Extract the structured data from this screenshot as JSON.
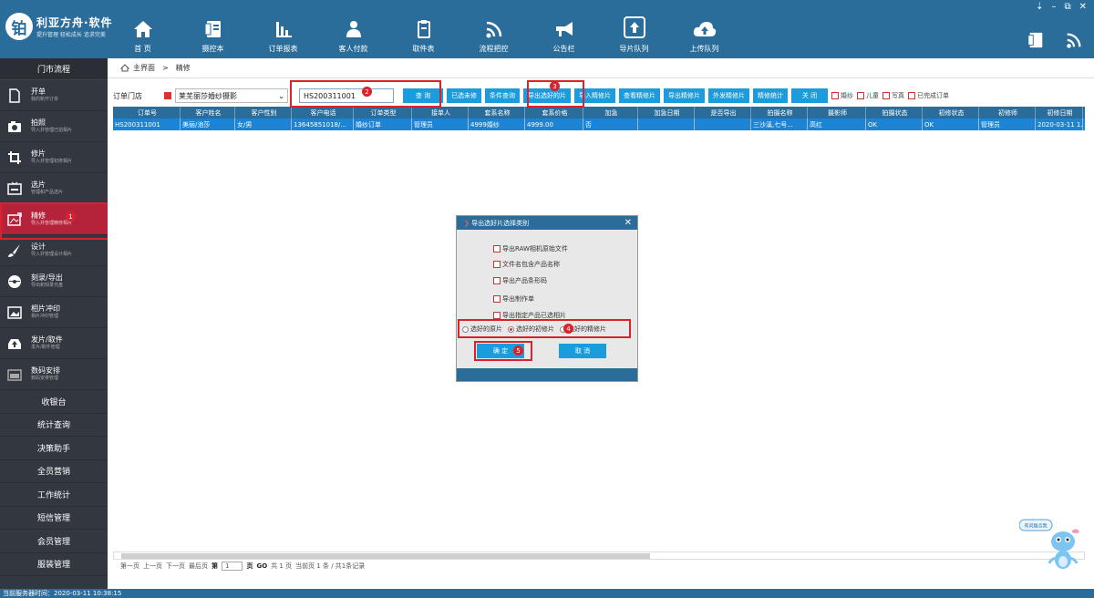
{
  "app": {
    "name": "利亚方舟·软件",
    "slogan": "提升管理 轻松成长 追求完美",
    "logo_char": "铂"
  },
  "topnav": [
    {
      "label": "首 页",
      "icon": "home-icon"
    },
    {
      "label": "摄控本",
      "icon": "notebook-icon"
    },
    {
      "label": "订单报表",
      "icon": "bar-chart-icon"
    },
    {
      "label": "客人付款",
      "icon": "customer-icon"
    },
    {
      "label": "取件表",
      "icon": "clipboard-icon"
    },
    {
      "label": "流程把控",
      "icon": "signal-icon"
    },
    {
      "label": "公告栏",
      "icon": "megaphone-icon"
    },
    {
      "label": "导片队列",
      "icon": "upload-box-icon"
    },
    {
      "label": "上传队列",
      "icon": "cloud-upload-icon"
    }
  ],
  "window": {
    "controls": [
      "⇣",
      "–",
      "⧉",
      "✕"
    ]
  },
  "sidebar": {
    "header": "门市流程",
    "items": [
      {
        "title": "开单",
        "sub": "我的新开订单",
        "icon": "document-icon"
      },
      {
        "title": "拍照",
        "sub": "导入并管理已拍相片",
        "icon": "camera-icon"
      },
      {
        "title": "修片",
        "sub": "导入并管理初修相片",
        "icon": "crop-icon"
      },
      {
        "title": "选片",
        "sub": "管理和产品选片",
        "icon": "screen-icon"
      },
      {
        "title": "精修",
        "sub": "导入并管理精修相片",
        "icon": "image-edit-icon"
      },
      {
        "title": "设计",
        "sub": "导入并管理设计相片",
        "icon": "brush-icon"
      },
      {
        "title": "刻录/导出",
        "sub": "导出和刻录光盘",
        "icon": "disc-icon"
      },
      {
        "title": "相片冲印",
        "sub": "相片冲印管理",
        "icon": "photo-icon"
      },
      {
        "title": "发片/取件",
        "sub": "发片/取件管理",
        "icon": "tray-upload-icon"
      },
      {
        "title": "数码安排",
        "sub": "数码安排管理",
        "icon": "calendar-icon"
      }
    ],
    "plain": [
      "收银台",
      "统计查询",
      "决策助手",
      "全员营销",
      "工作统计",
      "短信管理",
      "会员管理",
      "服装管理"
    ]
  },
  "breadcrumb": {
    "home": "主界面",
    "sep": ">",
    "current": "精修"
  },
  "toolbar": {
    "store_select": "订单门店",
    "studio_select": "莱芜丽莎婚纱摄影",
    "order_input": "HS200311001",
    "buttons": [
      "查 询",
      "已选未修",
      "条件查询",
      "导出选好的片",
      "导入精修片",
      "查看精修片",
      "导出精修片",
      "外发精修片",
      "精修统计",
      "关 闭"
    ],
    "checks": [
      "婚纱",
      "儿童",
      "写真",
      "已完成订单"
    ]
  },
  "table": {
    "columns": [
      "订单号",
      "客户姓名",
      "客户性别",
      "客户电话",
      "订单类型",
      "接单人",
      "套系名称",
      "套系价格",
      "加急",
      "加急日期",
      "是否导出",
      "拍摄名称",
      "摄影师",
      "拍摄状态",
      "初修状态",
      "初修师",
      "初修日期"
    ],
    "rows": [
      [
        "HS200311001",
        "美丽/池莎",
        "女/男",
        "13645851018/...",
        "婚纱订单",
        "管理员",
        "4999婚纱",
        "4999.00",
        "否",
        "",
        "",
        "三沙溪,七号...",
        "高红",
        "OK",
        "OK",
        "管理员",
        "2020-03-11 1..."
      ]
    ]
  },
  "pager": {
    "first": "第一页",
    "prev": "上一页",
    "next": "下一页",
    "last": "最后页",
    "page_prefix": "第",
    "page_value": "1",
    "page_suffix": "页",
    "go": "GO",
    "total": "共 1 页",
    "current": "当前页 1 条 / 共1条记录"
  },
  "dialog": {
    "title": "导出选好片选择类别",
    "options": [
      "导出RAW相机原始文件",
      "文件名包含产品名称",
      "导出产品条形码",
      "导出制作单",
      "导出指定产品已选相片"
    ],
    "radios": [
      {
        "label": "选好的原片",
        "checked": false
      },
      {
        "label": "选好的初修片",
        "checked": true
      },
      {
        "label": "选好的精修片",
        "checked": false
      }
    ],
    "ok": "确 定",
    "cancel": "取 消"
  },
  "markers": [
    "1",
    "2",
    "3",
    "4",
    "5"
  ],
  "mascot_text": "有问题点我",
  "status": {
    "server_time": "当前服务器时间：2020-03-11 10:38:15"
  },
  "colors": {
    "primary": "#2a6d9b",
    "accent": "#1b9cdc",
    "sidebar": "#333740",
    "active": "#b5233a",
    "highlight": "#d9222e"
  }
}
